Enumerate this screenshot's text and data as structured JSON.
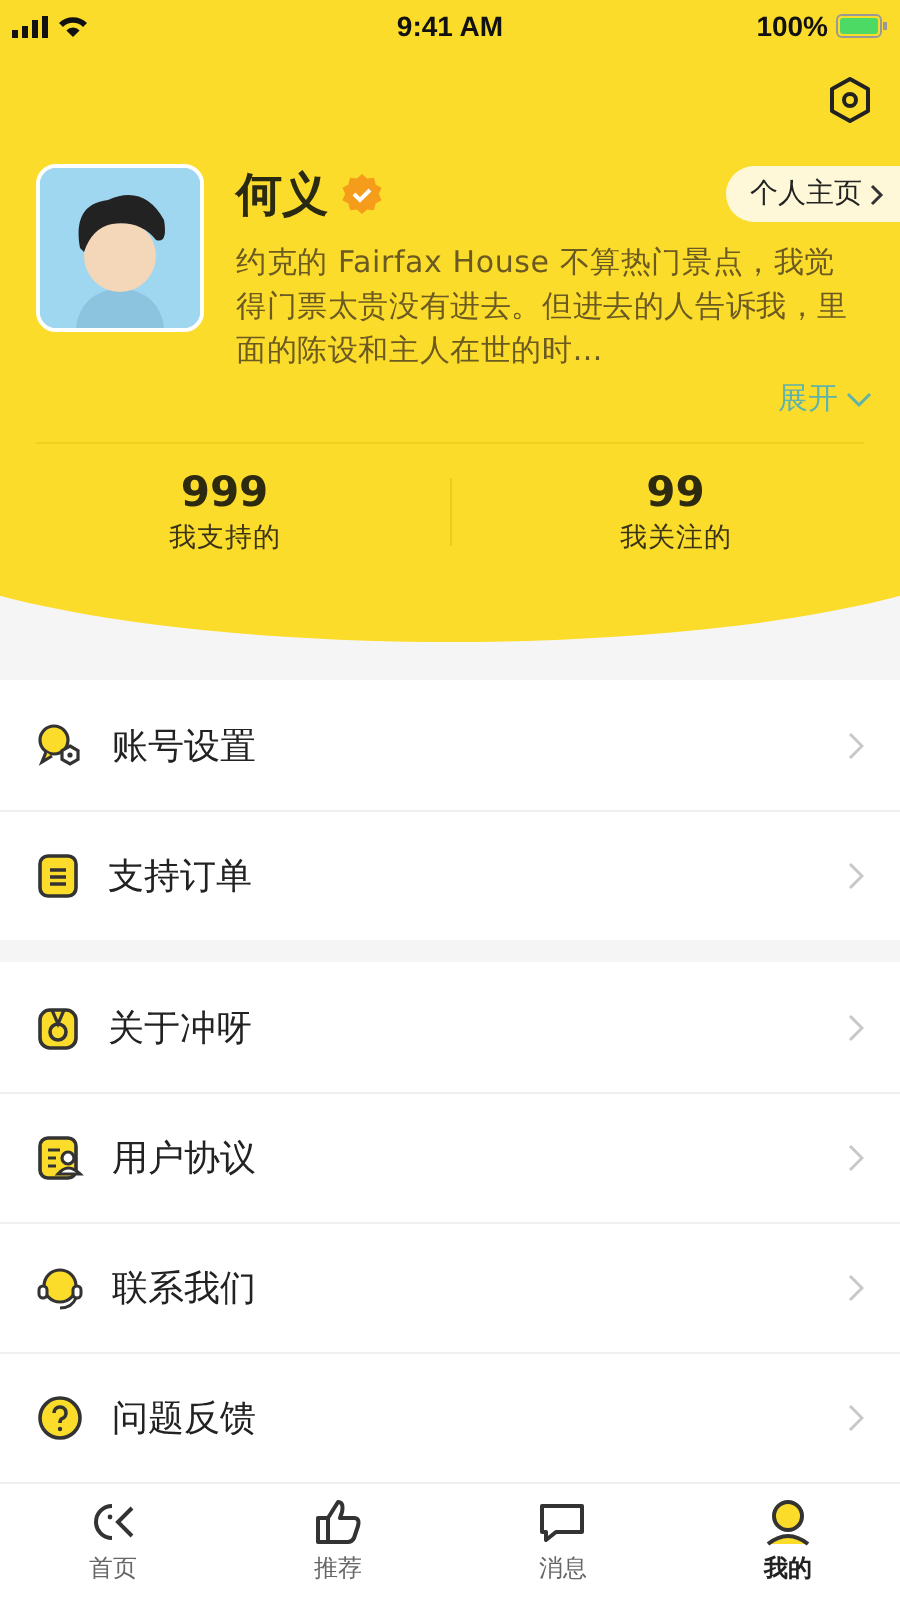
{
  "status_bar": {
    "time": "9:41 AM",
    "battery": "100%"
  },
  "profile": {
    "name": "何义",
    "verified": true,
    "homepage_button": "个人主页",
    "bio": "约克的 Fairfax House 不算热门景点，我觉得门票太贵没有进去。但进去的人告诉我，里面的陈设和主人在世的时…",
    "expand": "展开",
    "stats": [
      {
        "value": "999",
        "label": "我支持的"
      },
      {
        "value": "99",
        "label": "我关注的"
      }
    ]
  },
  "menu_groups": [
    [
      {
        "label": "账号设置"
      },
      {
        "label": "支持订单"
      }
    ],
    [
      {
        "label": "关于冲呀"
      },
      {
        "label": "用户协议"
      },
      {
        "label": "联系我们"
      },
      {
        "label": "问题反馈"
      }
    ]
  ],
  "tab_bar": [
    {
      "label": "首页",
      "selected": false
    },
    {
      "label": "推荐",
      "selected": false
    },
    {
      "label": "消息",
      "selected": false
    },
    {
      "label": "我的",
      "selected": true
    }
  ]
}
